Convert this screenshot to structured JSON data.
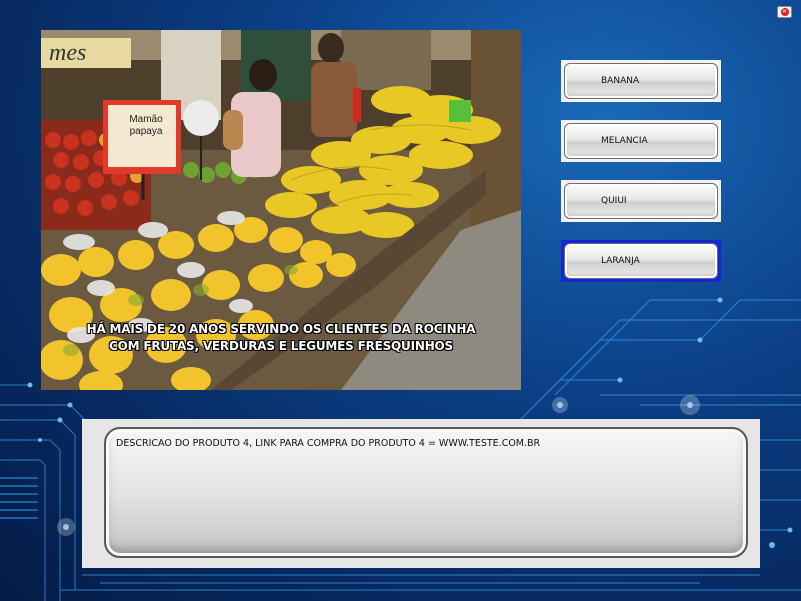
{
  "video": {
    "sign_text": "Mamão\npapaya",
    "caption_line1": "HÁ MAIS DE 20 ANOS SERVINDO OS CLIENTES DA ROCINHA",
    "caption_line2": "COM FRUTAS, VERDURAS E LEGUMES FRESQUINHOS"
  },
  "products": [
    {
      "label": "BANANA",
      "selected": false
    },
    {
      "label": "MELANCIA",
      "selected": false
    },
    {
      "label": "QUIUI",
      "selected": false
    },
    {
      "label": "LARANJA",
      "selected": true
    }
  ],
  "description": {
    "text": "DESCRICAO DO PRODUTO 4, LINK PARA COMPRA DO PRODUTO 4 = WWW.TESTE.COM.BR"
  },
  "close_icon": "close-icon",
  "colors": {
    "background": "#0b3f86",
    "selected_border": "#1526d6",
    "close_red": "#e02020"
  }
}
